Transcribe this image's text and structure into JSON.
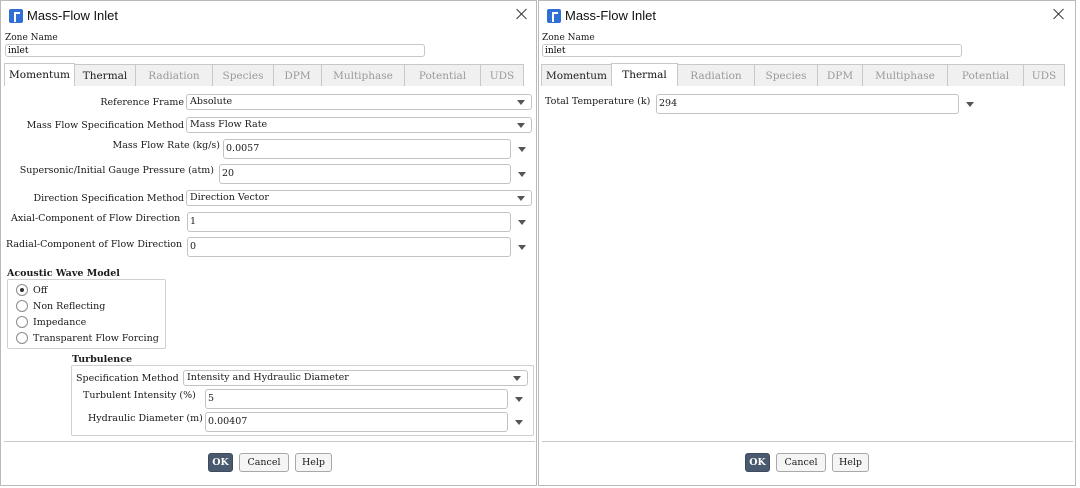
{
  "dialogs": {
    "left": {
      "title": "Mass-Flow Inlet",
      "zone_name_label": "Zone Name",
      "zone_name": "inlet"
    },
    "right": {
      "title": "Mass-Flow Inlet",
      "zone_name_label": "Zone Name",
      "zone_name": "inlet"
    }
  },
  "tabs": [
    "Momentum",
    "Thermal",
    "Radiation",
    "Species",
    "DPM",
    "Multiphase",
    "Potential",
    "UDS"
  ],
  "momentum": {
    "reference_frame": {
      "label": "Reference Frame",
      "value": "Absolute"
    },
    "mass_flow_spec": {
      "label": "Mass Flow Specification Method",
      "value": "Mass Flow Rate"
    },
    "mass_flow_rate": {
      "label": "Mass Flow Rate (kg/s)",
      "value": "0.0057"
    },
    "gauge_pressure": {
      "label": "Supersonic/Initial Gauge Pressure (atm)",
      "value": "20"
    },
    "direction_spec": {
      "label": "Direction Specification Method",
      "value": "Direction Vector"
    },
    "axial": {
      "label": "Axial-Component of Flow Direction",
      "value": "1"
    },
    "radial": {
      "label": "Radial-Component of Flow Direction",
      "value": "0"
    },
    "acoustic": {
      "title": "Acoustic Wave Model",
      "options": [
        "Off",
        "Non Reflecting",
        "Impedance",
        "Transparent Flow Forcing"
      ],
      "selected": "Off"
    },
    "turbulence": {
      "title": "Turbulence",
      "spec_method": {
        "label": "Specification Method",
        "value": "Intensity and Hydraulic Diameter"
      },
      "intensity": {
        "label": "Turbulent Intensity (%)",
        "value": "5"
      },
      "diameter": {
        "label": "Hydraulic Diameter (m)",
        "value": "0.00407"
      }
    }
  },
  "thermal": {
    "total_temperature": {
      "label": "Total Temperature (k)",
      "value": "294"
    }
  },
  "buttons": {
    "ok": "OK",
    "cancel": "Cancel",
    "help": "Help"
  },
  "colors": {
    "accent": "#2f6fd6",
    "ok_button": "#4a5a6e"
  }
}
